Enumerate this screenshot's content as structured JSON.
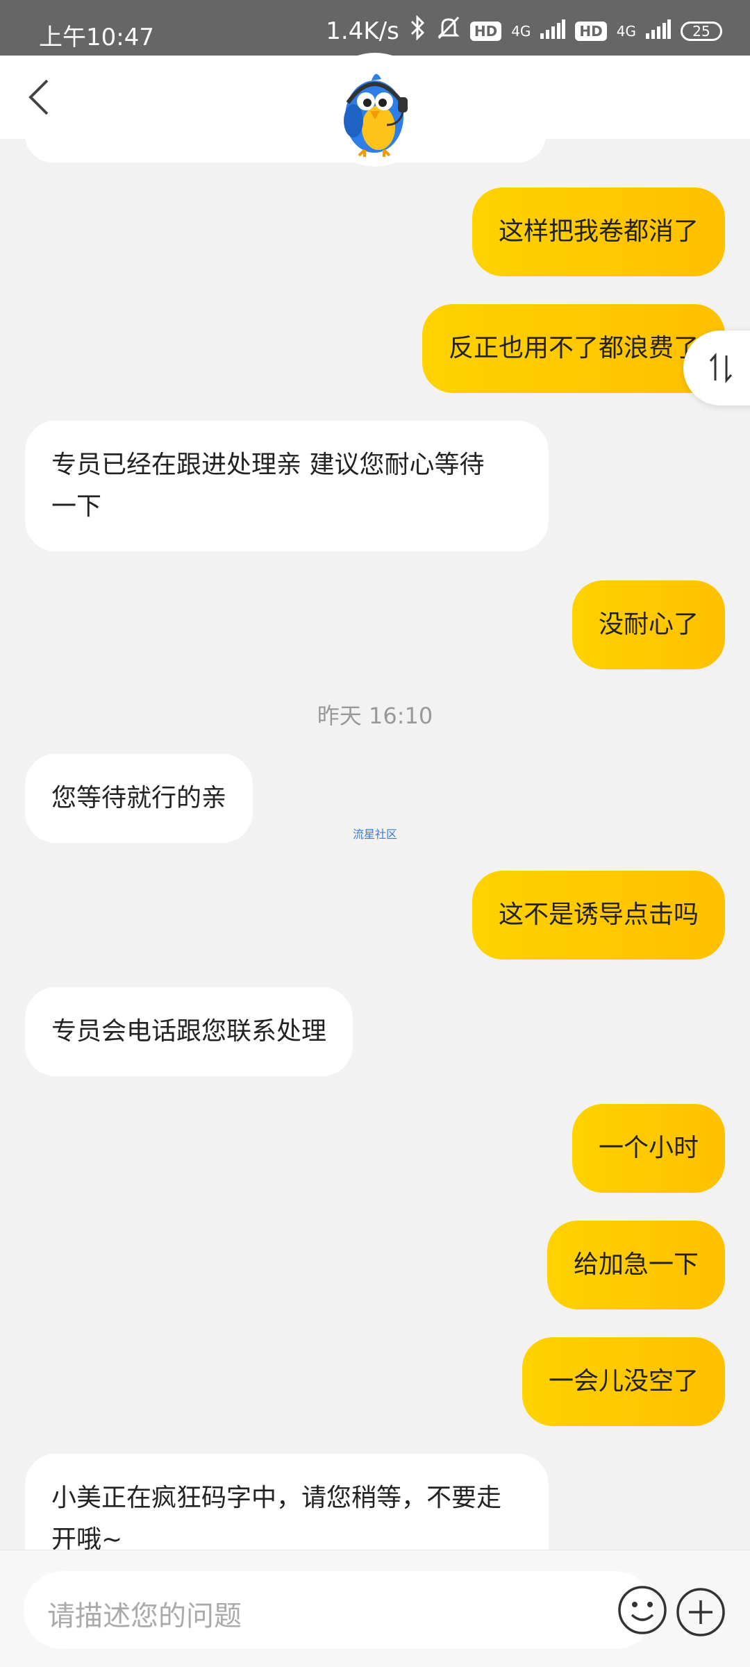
{
  "status_bar": {
    "time": "上午10:47",
    "net_speed": "1.4K/s",
    "hd1": "HD",
    "net1": "4G",
    "hd2": "HD",
    "net2": "4G",
    "battery": "25"
  },
  "header": {
    "back_icon": "chevron-left-icon",
    "avatar_icon": "bird-mascot-icon"
  },
  "messages": [
    {
      "side": "out",
      "text": "这样把我卷都消了"
    },
    {
      "side": "out",
      "text": "反正也用不了都浪费了"
    },
    {
      "side": "in",
      "line1": "专员已经在跟进处理亲 建议您耐心等待",
      "line2": "一下"
    },
    {
      "side": "out",
      "text": "没耐心了"
    },
    {
      "side": "in",
      "text": "您等待就行的亲"
    },
    {
      "side": "out",
      "text": "这不是诱导点击吗"
    },
    {
      "side": "in",
      "text": "专员会电话跟您联系处理"
    },
    {
      "side": "out",
      "text": "一个小时"
    },
    {
      "side": "out",
      "text": "给加急一下"
    },
    {
      "side": "out",
      "text": "一会儿没空了"
    },
    {
      "side": "in",
      "line1": "小美正在疯狂码字中，请您稍等，不要走",
      "line2": "开哦~"
    }
  ],
  "timestamp": "昨天 16:10",
  "watermark": "流星社区",
  "input": {
    "placeholder": "请描述您的问题",
    "emoji_icon": "smiley-icon",
    "plus_icon": "plus-circle-icon"
  },
  "float_button_icon": "swap-vertical-icon",
  "colors": {
    "outgoing_bubble": "#ffc800",
    "incoming_bubble": "#ffffff",
    "background": "#f2f2f2",
    "status_bar": "#666666"
  }
}
